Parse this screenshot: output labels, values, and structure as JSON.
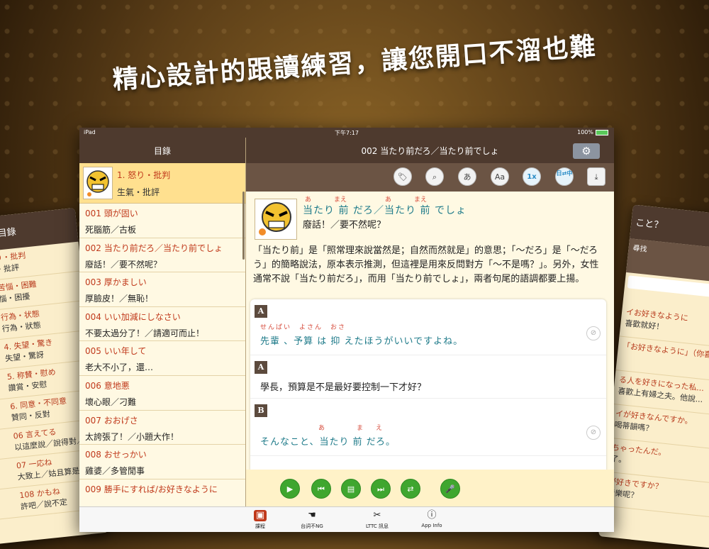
{
  "headline": "精心設計的跟讀練習，讓您開口不溜也難",
  "status_bar": {
    "device": "iPad",
    "time": "下午7:17",
    "battery": "100%"
  },
  "left_nav": {
    "title": "目錄"
  },
  "chapter": {
    "title": "1. 怒り・批判",
    "subtitle": "生氣・批評"
  },
  "lessons": [
    {
      "ja": "001 頭が固い",
      "zh": "死腦筋／古板"
    },
    {
      "ja": "002 当たり前だろ／当たり前でしょ",
      "zh": "廢話！／要不然呢？"
    },
    {
      "ja": "003 厚かましい",
      "zh": "厚臉皮！／無恥！"
    },
    {
      "ja": "004 いい加減にしなさい",
      "zh": "不要太過分了！／請適可而止！"
    },
    {
      "ja": "005 いい年して",
      "zh": "老大不小了，還…"
    },
    {
      "ja": "006 意地悪",
      "zh": "壞心眼／刁難"
    },
    {
      "ja": "007 おおげさ",
      "zh": "太誇張了！／小題大作！"
    },
    {
      "ja": "008 おせっかい",
      "zh": "雞婆／多管閒事"
    },
    {
      "ja": "009 勝手にすれば/お好きなように",
      "zh": ""
    }
  ],
  "right_nav": {
    "title": "002 当たり前だろ／当たり前でしょ",
    "settings_icon": "gear-icon"
  },
  "toolbar": {
    "tag": "tag-icon",
    "search": "search-icon",
    "kana": "あ",
    "font": "Aa",
    "speed": "1x",
    "lang": "日⇄中",
    "download": "download-icon"
  },
  "phrase": {
    "ruby": [
      "あ",
      "まえ",
      "あ",
      "まえ"
    ],
    "jp": "当たり 前 だろ／当たり 前 でしょ",
    "zh": "廢話！／要不然呢？"
  },
  "explanation": "「当たり前」是「照常理來說當然是；自然而然就是」的意思；「～だろ」是「～だろう」的簡略說法，原本表示推測，但這裡是用來反問對方「～不是嗎？」。另外，女性通常不說「当たり前だろ」，而用「当たり前でしょ」，兩者句尾的語調都要上揚。",
  "dialog": [
    {
      "speaker": "A",
      "ruby": "せんぱい　よさん　おさ",
      "text": "先輩 、予算 は 抑 えたほうがいいですよね。",
      "japanese": true
    },
    {
      "speaker": "A",
      "ruby": "",
      "text": "學長，預算是不是最好要控制一下才好？",
      "japanese": false
    },
    {
      "speaker": "B",
      "ruby": "あ　まえ",
      "text": "そんなこと、当たり 前 だろ。",
      "japanese": true
    }
  ],
  "controls": {
    "play": "play-icon",
    "prev": "previous-icon",
    "script": "script-icon",
    "next": "next-icon",
    "repeat": "repeat-icon",
    "mic": "microphone-icon"
  },
  "tabs": [
    {
      "label": "課程",
      "icon": "book-icon"
    },
    {
      "label": "台詞不NG",
      "icon": "hand-icon"
    },
    {
      "label": "LTTC 訊息",
      "icon": "tools-icon"
    },
    {
      "label": "App Info",
      "icon": "info-icon"
    }
  ],
  "side_left": {
    "title": "目錄",
    "rows": [
      {
        "a": "り・批判",
        "b": "・批評"
      },
      {
        "a": "苦惱・困難",
        "b": "惱・困擾"
      },
      {
        "a": "行為・状態",
        "b": "行為・狀態"
      },
      {
        "a": "4. 失望・驚き",
        "b": "失望・驚訝"
      },
      {
        "a": "5. 称賛・慰め",
        "b": "讚賞・安慰"
      },
      {
        "a": "6. 同意・不同意",
        "b": "贊同・反對"
      },
      {
        "a": "06 言えてる",
        "b": "以這麼說／說得對／"
      },
      {
        "a": "07 一応ね",
        "b": "大致上／姑且算是"
      },
      {
        "a": "108 かもね",
        "b": "許吧／說不定"
      }
    ]
  },
  "side_right": {
    "title": "こと？",
    "search": "尋找",
    "header": "日文",
    "rows": [
      {
        "a": "イお好きなように",
        "b": "喜歡就好！"
      },
      {
        "a": "「お好きなように」（你喜",
        "b": ""
      },
      {
        "a": "る人を好きになった私...",
        "b": "喜歡上有婦之夫。他說..."
      },
      {
        "a": "イが好きなんですか。",
        "b": "喝蒂韻嗎？"
      },
      {
        "a": "ちゃったんだ。",
        "b": "了。"
      },
      {
        "a": "が好きですか？",
        "b": "音樂呢？"
      }
    ]
  }
}
